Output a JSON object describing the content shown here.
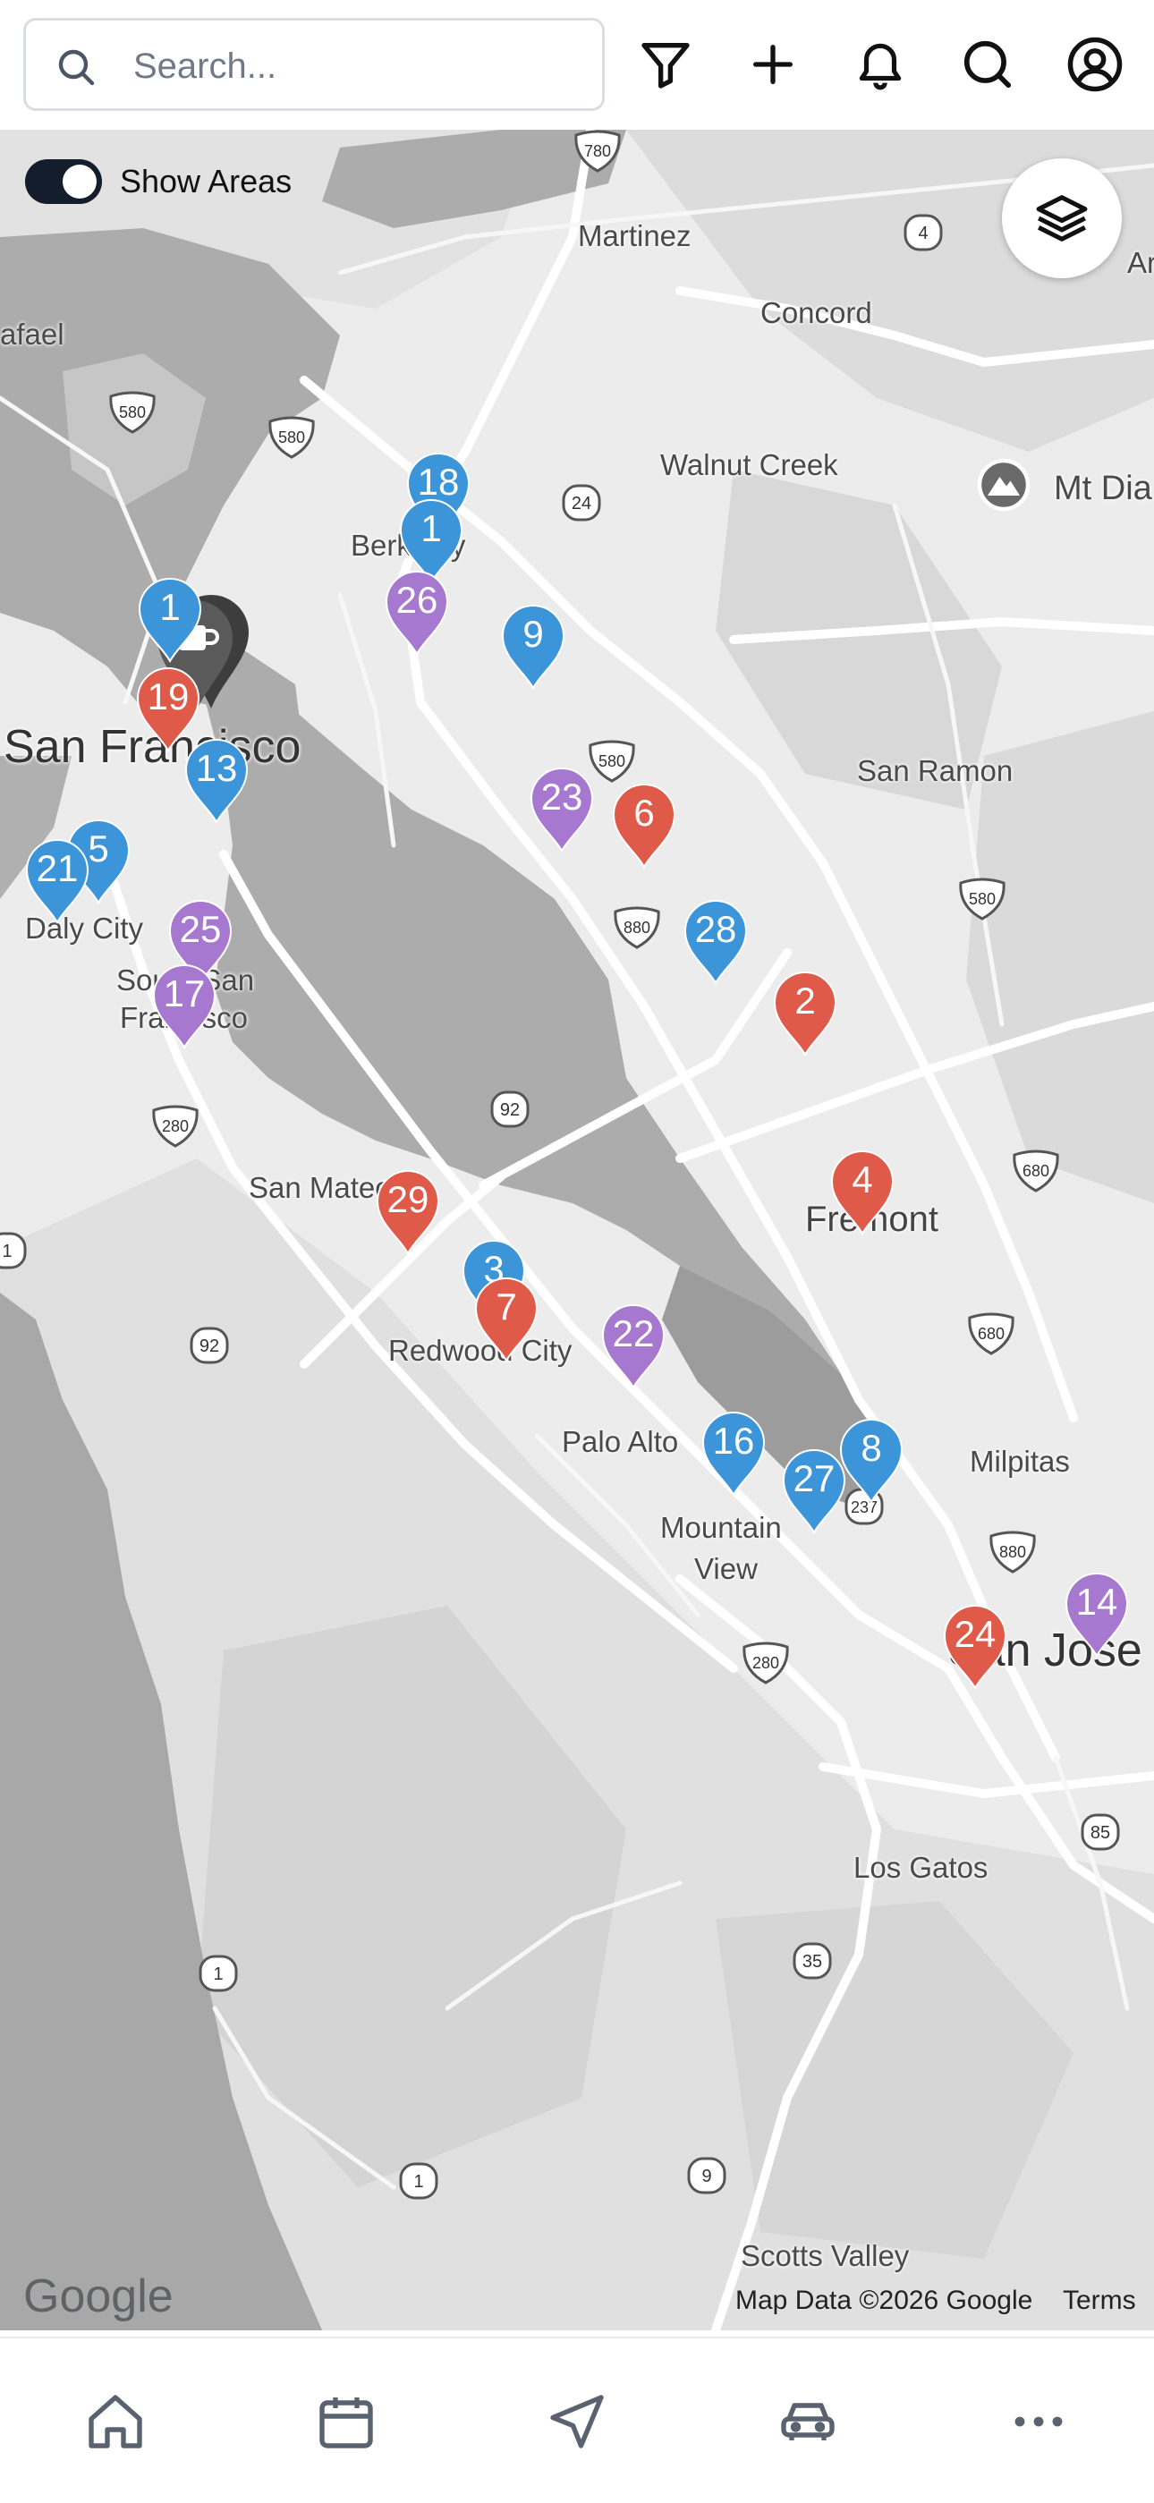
{
  "search": {
    "placeholder": "Search..."
  },
  "toggle": {
    "label": "Show Areas",
    "on": true
  },
  "colors": {
    "accent": "#141d2b",
    "pin_red": "#e05a4a",
    "pin_blue": "#3b95d8",
    "pin_purple": "#a678cf",
    "pin_dark": "#4d4d4d"
  },
  "map": {
    "cities": {
      "martinez": "Martinez",
      "concord": "Concord",
      "walnut_creek": "Walnut Creek",
      "mt_diablo": "Mt Dia",
      "berkeley": "Berkeley",
      "san_francisco": "San Francisco",
      "san_ramon": "San Ramon",
      "daly_city": "Daly City",
      "south_sf_1": "South San",
      "south_sf_2": "Francisco",
      "san_mateo": "San Mateo",
      "fremont": "Fremont",
      "redwood_city": "Redwood City",
      "palo_alto": "Palo Alto",
      "milpitas": "Milpitas",
      "mountain_view_1": "Mountain",
      "mountain_view_2": "View",
      "san_jose": "San Jose",
      "los_gatos": "Los Gatos",
      "scotts_valley": "Scotts Valley",
      "rafael": "afael",
      "ar": "Ar"
    },
    "shields": [
      "780",
      "4",
      "580",
      "580",
      "24",
      "580",
      "580",
      "880",
      "680",
      "92",
      "280",
      "1",
      "92",
      "680",
      "880",
      "280",
      "237",
      "85",
      "35",
      "1",
      "1",
      "9"
    ],
    "pins": [
      {
        "label": "18",
        "color": "blue"
      },
      {
        "label": "1",
        "color": "blue"
      },
      {
        "label": "26",
        "color": "purple"
      },
      {
        "label": "9",
        "color": "blue"
      },
      {
        "label": "1",
        "color": "blue"
      },
      {
        "label": "19",
        "color": "red"
      },
      {
        "label": "13",
        "color": "blue"
      },
      {
        "label": "23",
        "color": "purple"
      },
      {
        "label": "6",
        "color": "red"
      },
      {
        "label": "5",
        "color": "blue"
      },
      {
        "label": "21",
        "color": "blue"
      },
      {
        "label": "25",
        "color": "purple"
      },
      {
        "label": "17",
        "color": "purple"
      },
      {
        "label": "28",
        "color": "blue"
      },
      {
        "label": "2",
        "color": "red"
      },
      {
        "label": "4",
        "color": "red"
      },
      {
        "label": "29",
        "color": "red"
      },
      {
        "label": "3",
        "color": "blue"
      },
      {
        "label": "7",
        "color": "red"
      },
      {
        "label": "22",
        "color": "purple"
      },
      {
        "label": "16",
        "color": "blue"
      },
      {
        "label": "27",
        "color": "blue"
      },
      {
        "label": "8",
        "color": "blue"
      },
      {
        "label": "14",
        "color": "purple"
      },
      {
        "label": "24",
        "color": "red"
      }
    ],
    "google_logo": "Google",
    "map_data": "Map Data ©2026 Google",
    "terms": "Terms"
  },
  "icons": {
    "topbar": [
      "filter-icon",
      "plus-icon",
      "bell-icon",
      "search-icon",
      "account-icon"
    ],
    "nav": [
      "home-icon",
      "calendar-icon",
      "navigation-icon",
      "car-icon",
      "more-icon"
    ]
  }
}
